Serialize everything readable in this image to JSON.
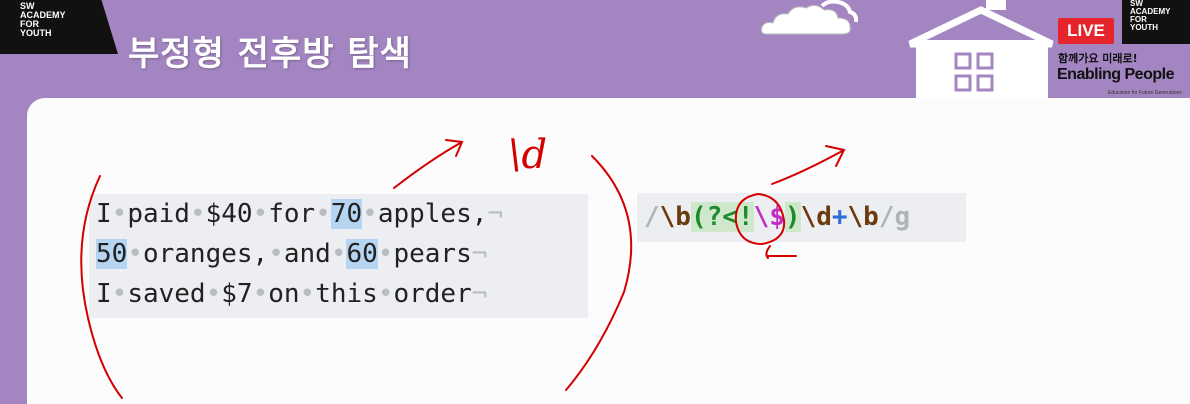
{
  "header": {
    "logo_left": "SW\nACADEMY\nFOR\nYOUTH",
    "title": "부정형 전후방 탐색",
    "live_label": "LIVE",
    "logo_right": "SW\nACADEMY\nFOR\nYOUTH",
    "tagline_korean": "함께가요 미래로!",
    "tagline_brand": "Enabling People",
    "tagline_small": "Education for Future Generations"
  },
  "sample_text": {
    "lines": [
      [
        {
          "t": "I"
        },
        {
          "t": "•",
          "ws": true
        },
        {
          "t": "paid"
        },
        {
          "t": "•",
          "ws": true
        },
        {
          "t": "$40"
        },
        {
          "t": "•",
          "ws": true
        },
        {
          "t": "for"
        },
        {
          "t": "•",
          "ws": true
        },
        {
          "t": "70",
          "hl": true
        },
        {
          "t": "•",
          "ws": true
        },
        {
          "t": "apples,"
        },
        {
          "t": "¬",
          "ws": true
        }
      ],
      [
        {
          "t": "50",
          "hl": true
        },
        {
          "t": "•",
          "ws": true
        },
        {
          "t": "oranges,"
        },
        {
          "t": "•",
          "ws": true
        },
        {
          "t": "and"
        },
        {
          "t": "•",
          "ws": true
        },
        {
          "t": "60",
          "hl": true
        },
        {
          "t": "•",
          "ws": true
        },
        {
          "t": "pears"
        },
        {
          "t": "¬",
          "ws": true
        }
      ],
      [
        {
          "t": "I"
        },
        {
          "t": "•",
          "ws": true
        },
        {
          "t": "saved"
        },
        {
          "t": "•",
          "ws": true
        },
        {
          "t": "$7"
        },
        {
          "t": "•",
          "ws": true
        },
        {
          "t": "on"
        },
        {
          "t": "•",
          "ws": true
        },
        {
          "t": "this"
        },
        {
          "t": "•",
          "ws": true
        },
        {
          "t": "order"
        },
        {
          "t": "¬",
          "ws": true
        }
      ]
    ]
  },
  "regex": {
    "parts": [
      {
        "t": "/",
        "c": "slash"
      },
      {
        "t": "\\b",
        "c": "esc"
      },
      {
        "t": "(?<!",
        "c": "grp"
      },
      {
        "t": "\\$",
        "c": "mag"
      },
      {
        "t": ")",
        "c": "grpo"
      },
      {
        "t": "\\d",
        "c": "esc"
      },
      {
        "t": "+",
        "c": "plus"
      },
      {
        "t": "\\b",
        "c": "esc"
      },
      {
        "t": "/",
        "c": "slash"
      },
      {
        "t": "g",
        "c": "flag"
      }
    ]
  },
  "handwritten_note": "\\d",
  "colors": {
    "background": "#a385c1",
    "highlight": "#b6d5f2",
    "annotation": "#d40000",
    "live": "#e5242b"
  }
}
